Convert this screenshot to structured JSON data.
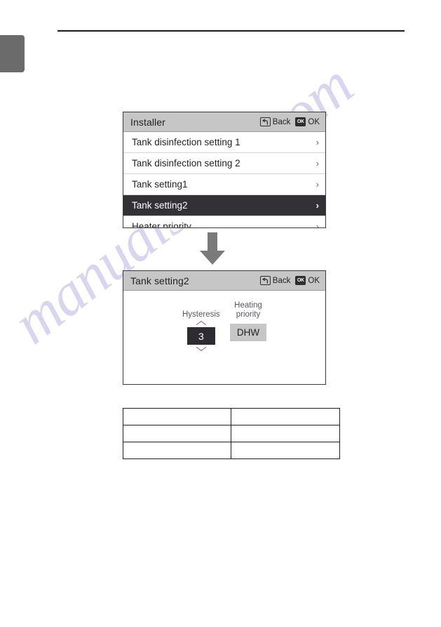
{
  "page": {
    "tab_marker": "",
    "watermark": "manualshive.com"
  },
  "screens": [
    {
      "id": "installer-list",
      "title": "Installer",
      "actions": [
        {
          "key_glyph": "back-arrow",
          "label": "Back"
        },
        {
          "key_glyph": "OK",
          "label": "OK"
        }
      ],
      "rows": [
        {
          "label": "Tank disinfection setting 1",
          "chevron": "›",
          "selected": false
        },
        {
          "label": "Tank disinfection setting 2",
          "chevron": "›",
          "selected": false
        },
        {
          "label": "Tank setting1",
          "chevron": "›",
          "selected": false
        },
        {
          "label": "Tank setting2",
          "chevron": "›",
          "selected": true
        },
        {
          "label": "Heater priority",
          "chevron": "›",
          "selected": false
        }
      ]
    },
    {
      "id": "tank-setting-2",
      "title": "Tank setting2",
      "actions": [
        {
          "key_glyph": "back-arrow",
          "label": "Back"
        },
        {
          "key_glyph": "OK",
          "label": "OK"
        }
      ],
      "fields": [
        {
          "name": "hysteresis",
          "label": "Hysteresis",
          "value": "3",
          "stepper_up": "⌃",
          "stepper_down": "⌄"
        },
        {
          "name": "heating-priority",
          "label": "Heating\npriority",
          "value": "DHW"
        }
      ]
    }
  ],
  "info_table": {
    "rows": [
      {
        "left": "",
        "right": ""
      },
      {
        "left": "",
        "right": ""
      },
      {
        "left": "",
        "right": ""
      }
    ]
  },
  "colors": {
    "header_bar": "#c6c6c6",
    "selected_row": "#333136",
    "value_box": "#2f2b33",
    "option_box": "#c6c6c6",
    "arrow": "#7a7a7a",
    "page_tab": "#6b6b6b"
  }
}
